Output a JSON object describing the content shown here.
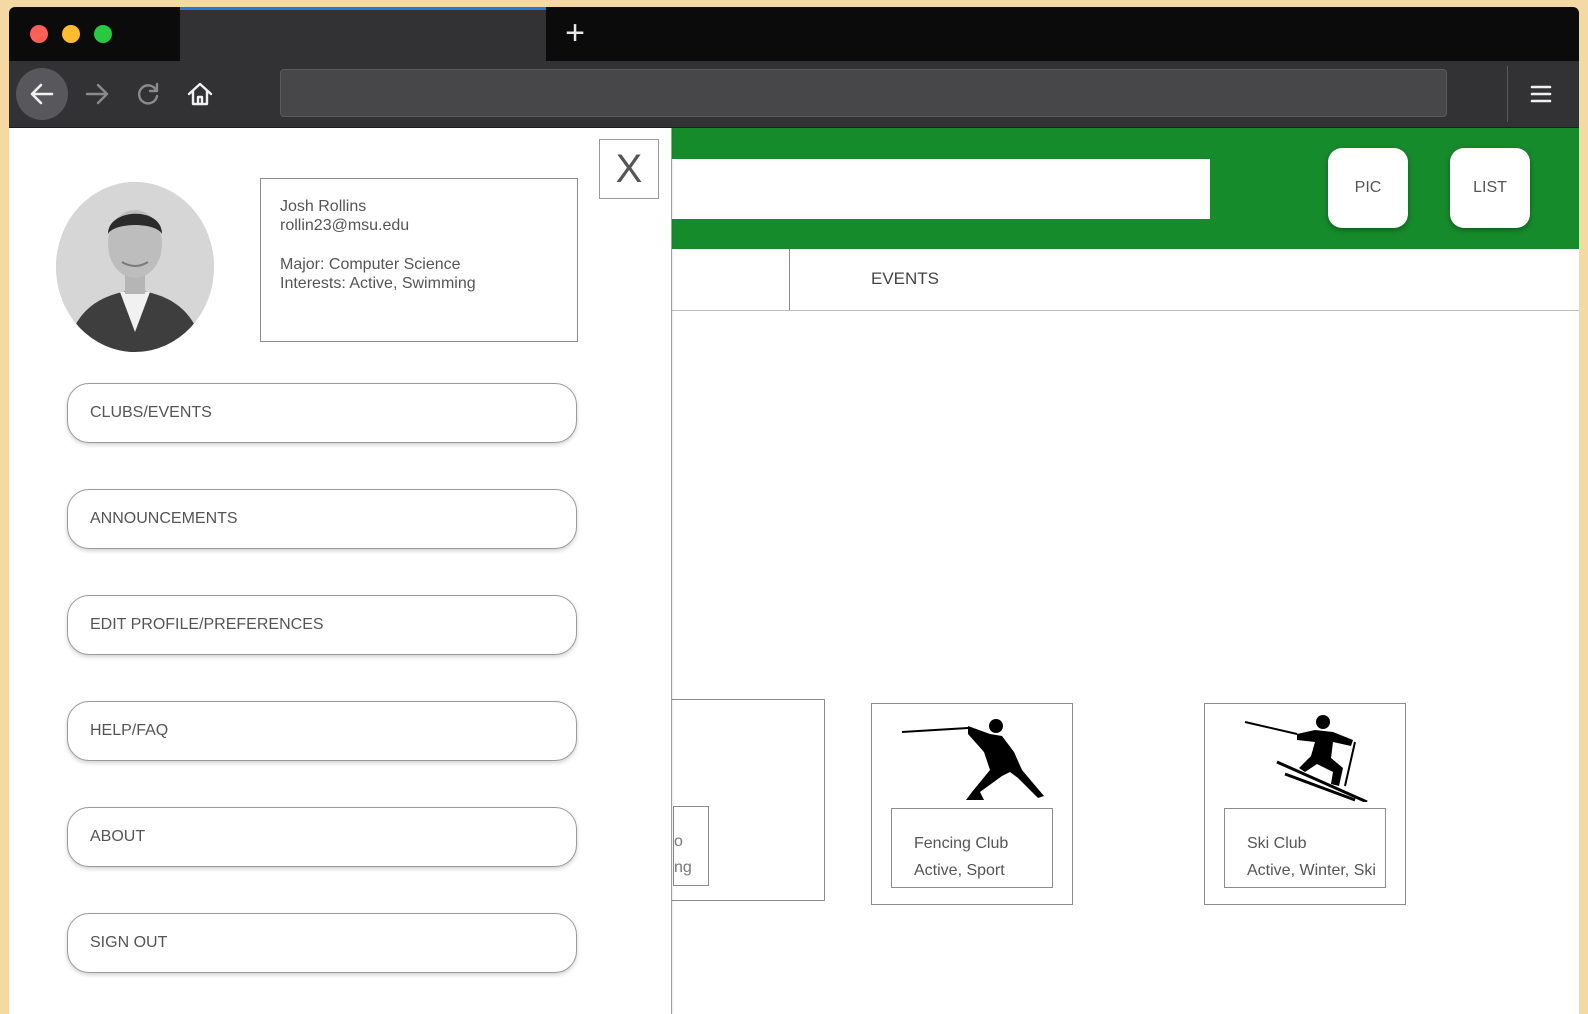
{
  "browser": {
    "new_tab_glyph": "+",
    "icons": [
      "back-arrow-icon",
      "forward-arrow-icon",
      "reload-icon",
      "home-icon",
      "hamburger-menu-icon"
    ],
    "tab_accent_color": "#1f7bd6"
  },
  "app": {
    "header_color": "#168b2c",
    "view_buttons": {
      "pic": "PIC",
      "list": "LIST"
    },
    "tabs": {
      "events": "EVENTS"
    },
    "cards": [
      {
        "name": "Fencing Club",
        "tags": "Active, Sport",
        "icon": "fencer-icon"
      },
      {
        "name": "Ski Club",
        "tags": "Active, Winter, Ski",
        "icon": "skier-icon"
      }
    ],
    "partial_card": {
      "name_fragment": "o",
      "tags_fragment": "ng"
    }
  },
  "drawer": {
    "close_label": "X",
    "profile": {
      "name": "Josh Rollins",
      "email": "rollin23@msu.edu",
      "major": "Major: Computer Science",
      "interests": "Interests: Active, Swimming"
    },
    "menu": [
      "CLUBS/EVENTS",
      "ANNOUNCEMENTS",
      "EDIT PROFILE/PREFERENCES",
      "HELP/FAQ",
      "ABOUT",
      "SIGN OUT"
    ]
  }
}
